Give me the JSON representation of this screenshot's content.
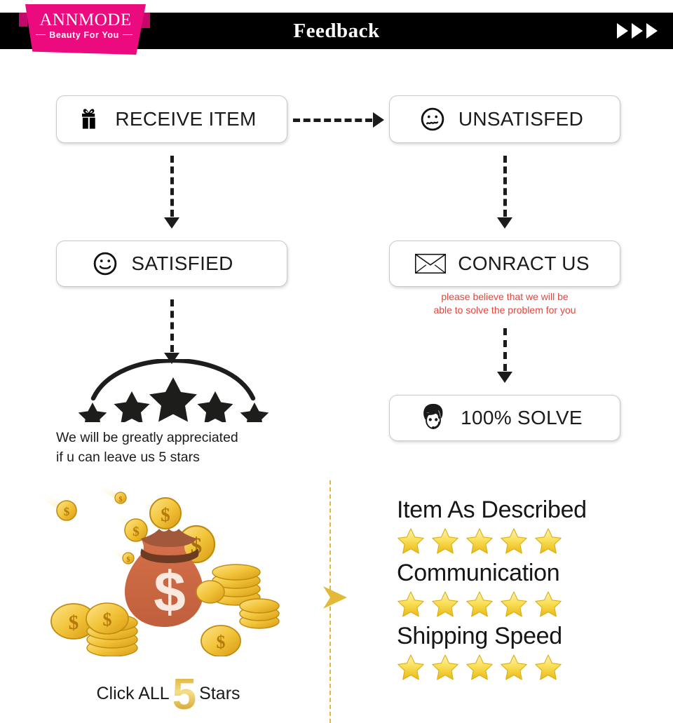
{
  "header": {
    "title": "Feedback",
    "arrow_count": 3,
    "bar_color": "#000000"
  },
  "logo": {
    "brand": "ANNMODE",
    "tagline": "Beauty For You",
    "ribbon_color": "#ec0a7f"
  },
  "flow": {
    "receive": {
      "label": "RECEIVE ITEM",
      "icon": "gift-icon"
    },
    "unsatisfied": {
      "label": "UNSATISFED",
      "icon": "sad-face-icon"
    },
    "satisfied": {
      "label": "SATISFIED",
      "icon": "happy-face-icon"
    },
    "contact": {
      "label": "CONRACT US",
      "icon": "envelope-icon"
    },
    "contact_note_line1": "please believe that we will be",
    "contact_note_line2": "able to solve the problem for you",
    "contact_note_color": "#e2453c",
    "solve": {
      "label": "100% SOLVE",
      "icon": "support-agent-icon"
    }
  },
  "appreciation": {
    "line1": "We will be greatly appreciated",
    "line2": "if u can leave us 5 stars",
    "star_count": 5
  },
  "bottom": {
    "click_prefix": "Click ALL",
    "click_number": "5",
    "click_suffix": "Stars",
    "number_color": "#d9a21a",
    "divider_color": "#e3b93a",
    "ratings": [
      {
        "label": "Item As Described",
        "stars": 5
      },
      {
        "label": "Communication",
        "stars": 5
      },
      {
        "label": "Shipping Speed",
        "stars": 5
      }
    ],
    "star_color": "#f8d73c"
  }
}
